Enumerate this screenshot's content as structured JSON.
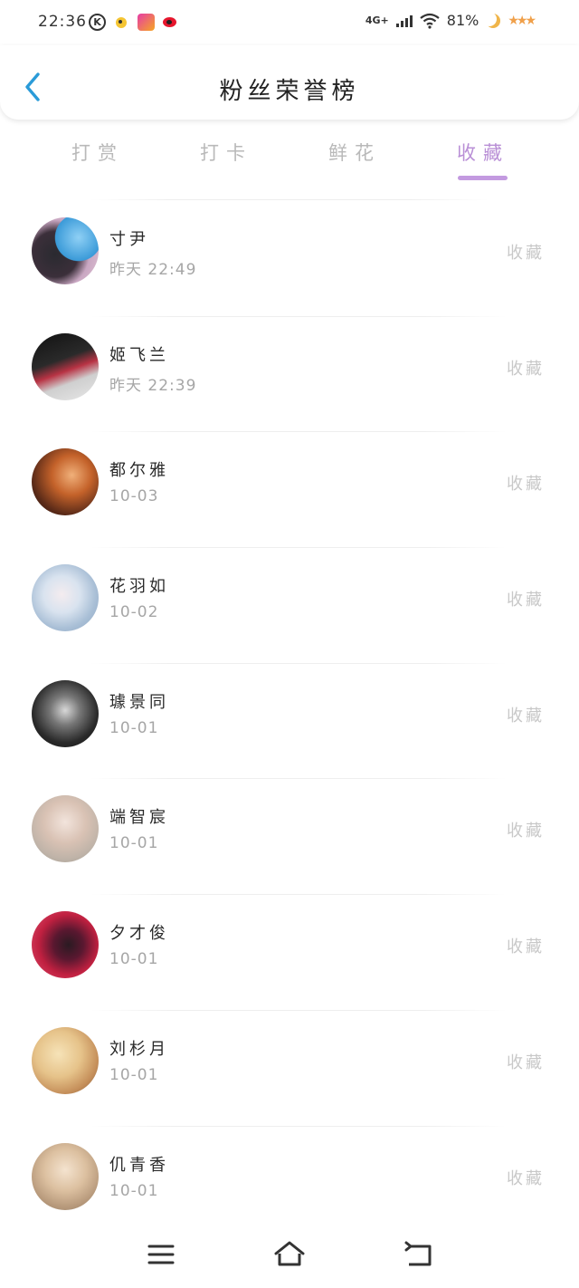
{
  "status_bar": {
    "time": "22:36",
    "network": "4G+",
    "battery": "81%",
    "icons": [
      "k-icon",
      "bird-icon",
      "live-app-icon",
      "weibo-icon",
      "wifi-icon",
      "signal-icon",
      "moon-icon",
      "stars-icon"
    ]
  },
  "header": {
    "title": "粉丝荣誉榜",
    "back_icon": "chevron-left-icon"
  },
  "tabs": [
    {
      "label": "打赏",
      "active": false
    },
    {
      "label": "打卡",
      "active": false
    },
    {
      "label": "鲜花",
      "active": false
    },
    {
      "label": "收藏",
      "active": true
    }
  ],
  "colors": {
    "accent": "#c39ae0",
    "accent_text": "#b98fd6",
    "back_arrow": "#2a9bd8",
    "inactive_tab": "#b9b9b9"
  },
  "list": [
    {
      "name": "寸尹",
      "time": "昨天 22:49",
      "action": "收藏",
      "avatar": "avatar-photo"
    },
    {
      "name": "姬飞兰",
      "time": "昨天 22:39",
      "action": "收藏",
      "avatar": "avatar-photo"
    },
    {
      "name": "都尔雅",
      "time": "10-03",
      "action": "收藏",
      "avatar": "avatar-photo"
    },
    {
      "name": "花羽如",
      "time": "10-02",
      "action": "收藏",
      "avatar": "avatar-photo"
    },
    {
      "name": "璩景同",
      "time": "10-01",
      "action": "收藏",
      "avatar": "avatar-photo"
    },
    {
      "name": "端智宸",
      "time": "10-01",
      "action": "收藏",
      "avatar": "avatar-photo"
    },
    {
      "name": "夕才俊",
      "time": "10-01",
      "action": "收藏",
      "avatar": "avatar-photo"
    },
    {
      "name": "刘杉月",
      "time": "10-01",
      "action": "收藏",
      "avatar": "avatar-photo"
    },
    {
      "name": "仉青香",
      "time": "10-01",
      "action": "收藏",
      "avatar": "avatar-photo"
    }
  ],
  "bottom_nav": {
    "icons": [
      "menu-icon",
      "home-icon",
      "back-icon"
    ]
  }
}
